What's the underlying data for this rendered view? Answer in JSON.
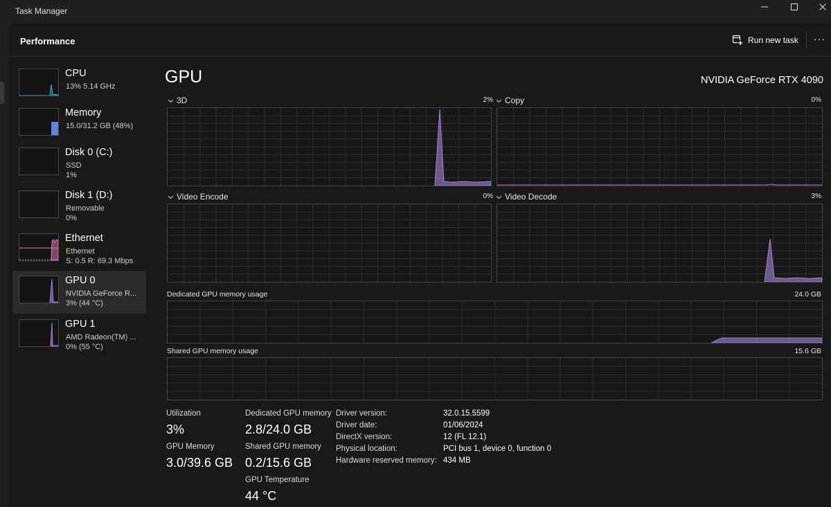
{
  "window": {
    "title": "Task Manager"
  },
  "header": {
    "page_title": "Performance",
    "run_new_task_label": "Run new task",
    "more_label": "···"
  },
  "sidebar": {
    "items": [
      {
        "name": "CPU",
        "line1": "13%  5.14 GHz",
        "line2": "",
        "color": "#3fb6d6"
      },
      {
        "name": "Memory",
        "line1": "15.0/31.2 GB (48%)",
        "line2": "",
        "color": "#6b7fd6"
      },
      {
        "name": "Disk 0 (C:)",
        "line1": "SSD",
        "line2": "1%",
        "color": "#5ec16b"
      },
      {
        "name": "Disk 1 (D:)",
        "line1": "Removable",
        "line2": "0%",
        "color": "#5ec16b"
      },
      {
        "name": "Ethernet",
        "line1": "Ethernet",
        "line2": "S: 0.5  R: 69.3 Mbps",
        "color": "#e27fb0"
      },
      {
        "name": "GPU 0",
        "line1": "NVIDIA GeForce R...",
        "line2": "3% (44 °C)",
        "color": "#a583d6"
      },
      {
        "name": "GPU 1",
        "line1": "AMD Radeon(TM) ...",
        "line2": "0% (55 °C)",
        "color": "#a583d6"
      }
    ]
  },
  "gpu": {
    "heading": "GPU",
    "model": "NVIDIA GeForce RTX 4090",
    "accent_color": "#a583d6",
    "engines": [
      {
        "name": "3D",
        "percent": "2%"
      },
      {
        "name": "Copy",
        "percent": "0%"
      },
      {
        "name": "Video Encode",
        "percent": "0%"
      },
      {
        "name": "Video Decode",
        "percent": "3%"
      }
    ],
    "dedicated_memory_label": "Dedicated GPU memory usage",
    "dedicated_memory_max": "24.0 GB",
    "shared_memory_label": "Shared GPU memory usage",
    "shared_memory_max": "15.6 GB"
  },
  "stats": {
    "utilization_label": "Utilization",
    "utilization_value": "3%",
    "gpu_memory_label": "GPU Memory",
    "gpu_memory_value": "3.0/39.6 GB",
    "dedicated_label": "Dedicated GPU memory",
    "dedicated_value": "2.8/24.0 GB",
    "shared_label": "Shared GPU memory",
    "shared_value": "0.2/15.6 GB",
    "temperature_label": "GPU Temperature",
    "temperature_value": "44 °C"
  },
  "info": [
    {
      "label": "Driver version:",
      "value": "32.0.15.5599"
    },
    {
      "label": "Driver date:",
      "value": "01/06/2024"
    },
    {
      "label": "DirectX version:",
      "value": "12 (FL 12.1)"
    },
    {
      "label": "Physical location:",
      "value": "PCI bus 1, device 0, function 0"
    },
    {
      "label": "Hardware reserved memory:",
      "value": "434 MB"
    }
  ]
}
